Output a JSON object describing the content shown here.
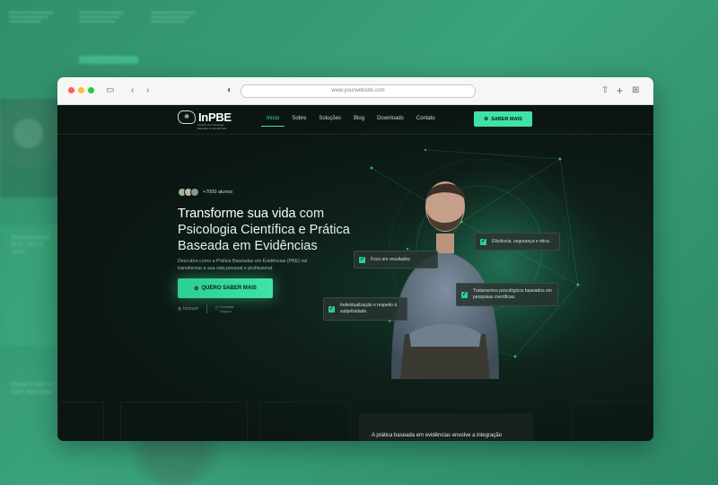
{
  "browser": {
    "url": "www.yourwebsite.com",
    "colors": {
      "close": "#ff5f57",
      "minimize": "#febc2e",
      "zoom": "#28c840"
    }
  },
  "background_page": {
    "text_1": "Sentia as experi",
    "text_2": "do Dr. Jan Lu",
    "text_3": "sente.",
    "text_4": "Quem é Jan Lu",
    "text_5": "CRP 06/27904"
  },
  "site": {
    "logo": {
      "mark_icon": "brain-icon",
      "text": "InPBE",
      "tagline": "Instituto de Psicologia Baseada em Evidências"
    },
    "nav": {
      "items": [
        {
          "label": "Início",
          "active": true
        },
        {
          "label": "Sobre",
          "active": false
        },
        {
          "label": "Soluções",
          "active": false
        },
        {
          "label": "Blog",
          "active": false
        },
        {
          "label": "Downloads",
          "active": false
        },
        {
          "label": "Contato",
          "active": false
        }
      ],
      "cta_label": "SABER MAIS"
    },
    "hero": {
      "students_label": "+7000 alunos",
      "headline_part1": "Transforme sua vida",
      "headline_part2": " com Psicologia Científica e Prática Baseada em Evidências",
      "subtitle": "Descubra como a Prática Baseadas em Evidências (PBE) vai transformar a sua vida pessoal e profissional.",
      "cta_label": "QUERO SABER MAIS",
      "trust_1": "hotmart",
      "trust_2": "Garantia Segura"
    },
    "tags": {
      "t1": "Foco em resultados",
      "t2": "Eficiência, segurança e ética.",
      "t3": "Tratamentos psicológicos baseados em pesquisas científicas.",
      "t4": "Individualização e respeito à subjetividade."
    },
    "bottom_card_text": "A prática baseada em evidências envolve a integração",
    "accent_color": "#3fe3a5"
  }
}
